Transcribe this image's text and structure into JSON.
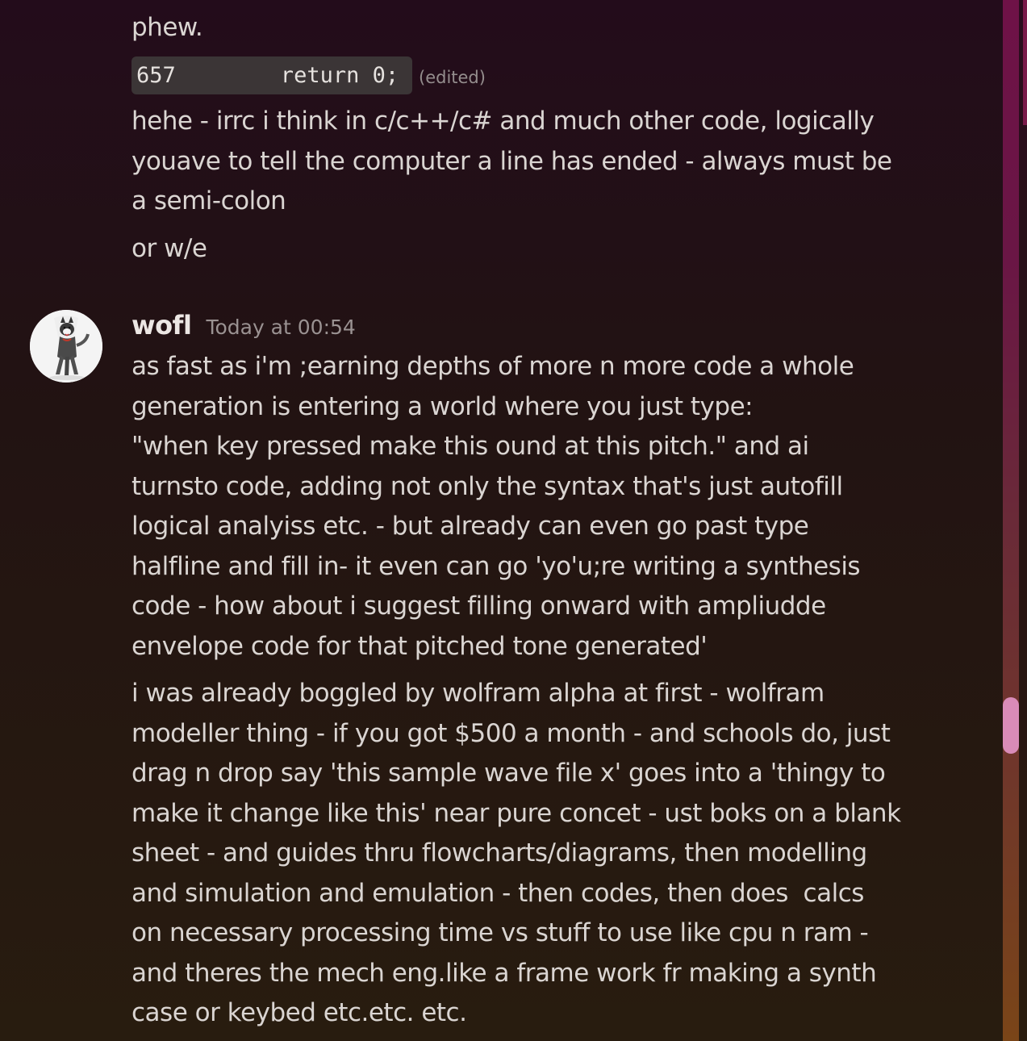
{
  "messages_prev": {
    "line_phew": "phew.",
    "code_snippet": "657        return 0;",
    "edited_label": "(edited)",
    "paragraph_semicolon": "hehe - irrc i think in c/c++/c# and much other code, logically\nyouave to tell the computer a line has ended - always must be\na semi-colon",
    "line_orwe": "or w/e"
  },
  "message_wofl": {
    "username": "wofl",
    "timestamp": "Today at 00:54",
    "avatar_icon": "husky-dog-avatar-icon",
    "paragraph_1": "as fast as i'm ;earning depths of more n more code a whole\ngeneration is entering a world where you just type:\n\"when key pressed make this ound at this pitch.\" and ai\nturnsto code, adding not only the syntax that's just autofill\nlogical analyiss etc. - but already can even go past type\nhalfline and fill in- it even can go 'yo'u;re writing a synthesis\ncode - how about i suggest filling onward with ampliudde\nenvelope code for that pitched tone generated'",
    "paragraph_2": "i was already boggled by wolfram alpha at first - wolfram\nmodeller thing - if you got $500 a month - and schools do, just\ndrag n drop say 'this sample wave file x' goes into a 'thingy to\nmake it change like this' near pure concet - ust boks on a blank\nsheet - and guides thru flowcharts/diagrams, then modelling\nand simulation and emulation - then codes, then does  calcs\non necessary processing time vs stuff to use like cpu n ram -\nand theres the mech eng.like a frame work fr making a synth\ncase or keybed etc.etc. etc."
  },
  "scrollbar": {
    "track_color": "#6e1247",
    "thumb_color": "#d98bb8",
    "position_fraction": 0.7
  }
}
